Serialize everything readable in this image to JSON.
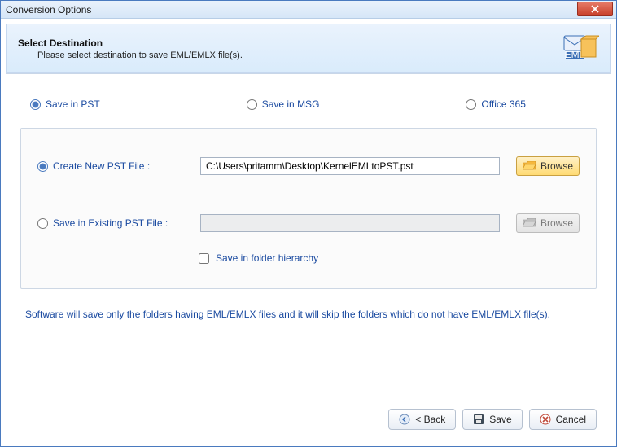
{
  "window": {
    "title": "Conversion Options"
  },
  "header": {
    "title": "Select Destination",
    "subtitle": "Please select destination to save EML/EMLX file(s)."
  },
  "save_options": {
    "pst": "Save in PST",
    "msg": "Save in MSG",
    "o365": "Office 365"
  },
  "pst": {
    "create_label": "Create New PST File :",
    "create_value": "C:\\Users\\pritamm\\Desktop\\KernelEMLtoPST.pst",
    "existing_label": "Save in Existing PST File :",
    "existing_value": "",
    "browse": "Browse",
    "hierarchy": "Save in folder hierarchy"
  },
  "note": "Software will save only the folders having EML/EMLX files and it will skip the folders which do not have EML/EMLX file(s).",
  "footer": {
    "back": "< Back",
    "save": "Save",
    "cancel": "Cancel"
  }
}
